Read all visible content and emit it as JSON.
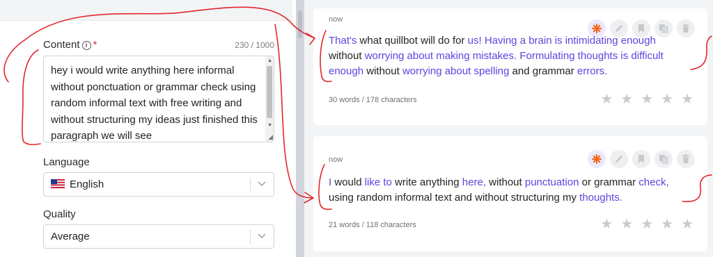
{
  "form": {
    "content": {
      "label": "Content",
      "info_glyph": "i",
      "required_mark": "*",
      "char_count": "230 / 1000",
      "value": "hey i would write anything here informal without ponctuation or grammar check using random informal text with free writing and without structuring my ideas just finished this paragraph we will see"
    },
    "language": {
      "label": "Language",
      "value": "English",
      "flag_icon": "us-flag-icon"
    },
    "quality": {
      "label": "Quality",
      "value": "Average"
    }
  },
  "results": [
    {
      "time": "now",
      "segments": [
        {
          "text": "That's",
          "hl": true
        },
        {
          "text": " what quillbot will do for ",
          "hl": false
        },
        {
          "text": "us!",
          "hl": true
        },
        {
          "text": " ",
          "hl": false
        },
        {
          "text": "Having a brain is intimidating enough",
          "hl": true
        },
        {
          "text": " without ",
          "hl": false
        },
        {
          "text": "worrying about making mistakes.",
          "hl": true
        },
        {
          "text": " ",
          "hl": false
        },
        {
          "text": "Formulating thoughts is difficult enough",
          "hl": true
        },
        {
          "text": " without ",
          "hl": false
        },
        {
          "text": "worrying about spelling",
          "hl": true
        },
        {
          "text": " and grammar ",
          "hl": false
        },
        {
          "text": "errors.",
          "hl": true
        }
      ],
      "stats": "30 words / 178 characters"
    },
    {
      "time": "now",
      "segments": [
        {
          "text": "I",
          "hl": true
        },
        {
          "text": " would ",
          "hl": false
        },
        {
          "text": "like to",
          "hl": true
        },
        {
          "text": " write anything ",
          "hl": false
        },
        {
          "text": "here,",
          "hl": true
        },
        {
          "text": " without ",
          "hl": false
        },
        {
          "text": "punctuation",
          "hl": true
        },
        {
          "text": " or grammar ",
          "hl": false
        },
        {
          "text": "check,",
          "hl": true
        },
        {
          "text": " using random informal text and without structuring my ",
          "hl": false
        },
        {
          "text": "thoughts.",
          "hl": true
        }
      ],
      "stats": "21 words / 118 characters"
    }
  ],
  "card_actions": [
    "ai-sparkle-icon",
    "edit-pencil-icon",
    "bookmark-icon",
    "copy-icon",
    "trash-icon"
  ],
  "rating": {
    "max_stars": 5,
    "value": 0
  },
  "colors": {
    "accent": "#5b45e0",
    "ai_icon": "#f06a22",
    "required": "#d9363e",
    "annotation": "#e3262b"
  }
}
